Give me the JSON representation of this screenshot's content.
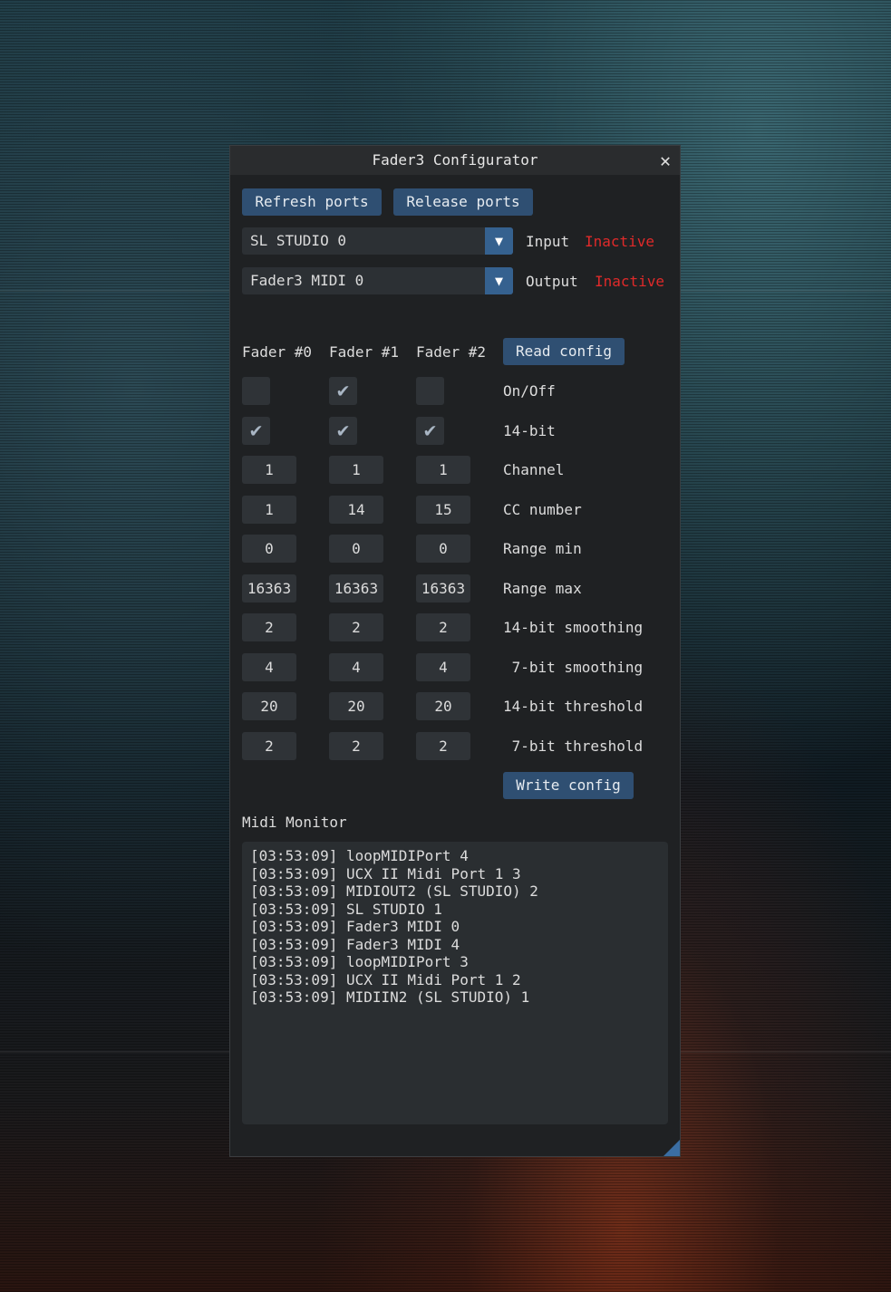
{
  "window": {
    "title": "Fader3 Configurator",
    "close_glyph": "✕"
  },
  "toolbar": {
    "refresh_label": "Refresh ports",
    "release_label": "Release ports"
  },
  "ports": {
    "input": {
      "selected": "SL STUDIO 0",
      "label": "Input",
      "status": "Inactive",
      "status_color": "#e02a2a"
    },
    "output": {
      "selected": "Fader3 MIDI 0",
      "label": "Output",
      "status": "Inactive",
      "status_color": "#e02a2a"
    },
    "arrow_glyph": "▼"
  },
  "faders": {
    "headers": [
      "Fader #0",
      "Fader #1",
      "Fader #2"
    ],
    "read_label": "Read config",
    "write_label": "Write config",
    "check_glyph": "✔",
    "onoff": {
      "label": "On/Off",
      "values": [
        false,
        true,
        false
      ]
    },
    "bit14": {
      "label": "14-bit",
      "values": [
        true,
        true,
        true
      ]
    },
    "rows": [
      {
        "label": "Channel",
        "values": [
          "1",
          "1",
          "1"
        ]
      },
      {
        "label": "CC number",
        "values": [
          "1",
          "14",
          "15"
        ]
      },
      {
        "label": "Range min",
        "values": [
          "0",
          "0",
          "0"
        ]
      },
      {
        "label": "Range max",
        "values": [
          "16363",
          "16363",
          "16363"
        ]
      },
      {
        "label": "14-bit smoothing",
        "values": [
          "2",
          "2",
          "2"
        ]
      },
      {
        "label": " 7-bit smoothing",
        "values": [
          "4",
          "4",
          "4"
        ]
      },
      {
        "label": "14-bit threshold",
        "values": [
          "20",
          "20",
          "20"
        ]
      },
      {
        "label": " 7-bit threshold",
        "values": [
          "2",
          "2",
          "2"
        ]
      }
    ]
  },
  "monitor": {
    "title": "Midi Monitor",
    "lines": [
      "[03:53:09] loopMIDIPort 4",
      "[03:53:09] UCX II Midi Port 1 3",
      "[03:53:09] MIDIOUT2 (SL STUDIO) 2",
      "[03:53:09] SL STUDIO 1",
      "[03:53:09] Fader3 MIDI 0",
      "[03:53:09] Fader3 MIDI 4",
      "[03:53:09] loopMIDIPort 3",
      "[03:53:09] UCX II Midi Port 1 2",
      "[03:53:09] MIDIIN2 (SL STUDIO) 1"
    ]
  },
  "colors": {
    "accent": "#2f4f72",
    "window_bg": "#1f2123",
    "frame_bg": "#2f3337",
    "check": "#a9b6c4"
  }
}
